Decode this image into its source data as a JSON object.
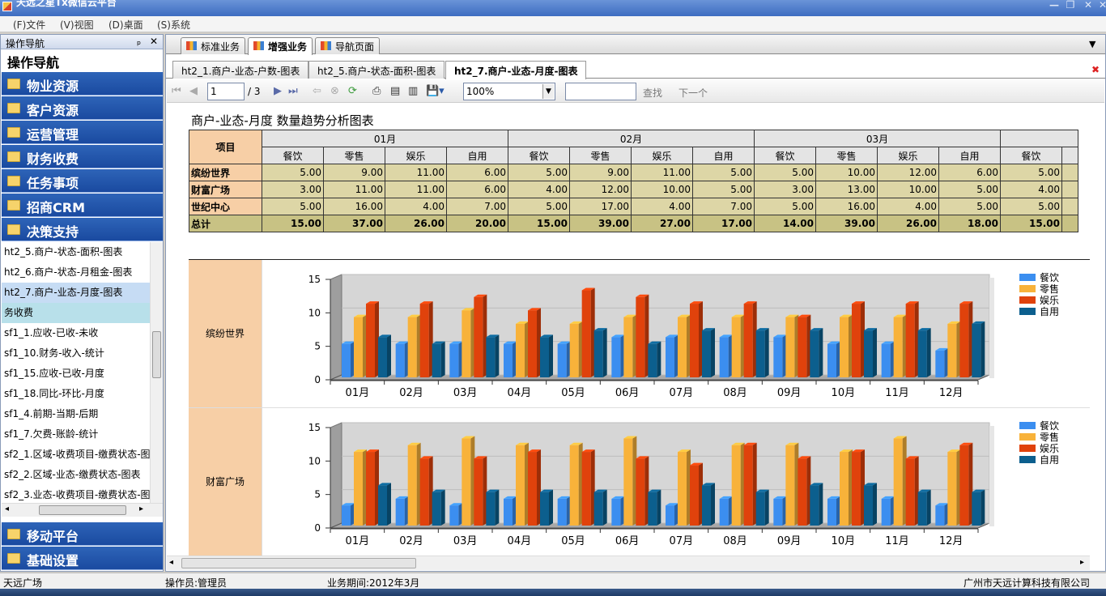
{
  "window": {
    "title": "天远之星Tx微信云平台"
  },
  "menu": [
    "(F)文件",
    "(V)视图",
    "(D)桌面",
    "(S)系统"
  ],
  "left_panel": {
    "header": "操作导航",
    "title": "操作导航",
    "nav_top": [
      "物业资源",
      "客户资源",
      "运营管理",
      "财务收费",
      "任务事项",
      "招商CRM",
      "决策支持"
    ],
    "sub_items": [
      "ht2_5.商户-状态-面积-图表",
      "ht2_6.商户-状态-月租金-图表",
      "ht2_7.商户-业态-月度-图表",
      "务收费",
      "sf1_1.应收-已收-未收",
      "sf1_10.财务-收入-统计",
      "sf1_15.应收-已收-月度",
      "sf1_18.同比-环比-月度",
      "sf1_4.前期-当期-后期",
      "sf1_7.欠费-账龄-统计",
      "sf2_1.区域-收费项目-缴费状态-图",
      "sf2_2.区域-业态-缴费状态-图表",
      "sf2_3.业态-收费项目-缴费状态-图"
    ],
    "nav_bottom": [
      "移动平台",
      "基础设置"
    ]
  },
  "top_tabs": [
    "标准业务",
    "增强业务",
    "导航页面"
  ],
  "sub_tabs": [
    "ht2_1.商户-业态-户数-图表",
    "ht2_5.商户-状态-面积-图表",
    "ht2_7.商户-业态-月度-图表"
  ],
  "toolbar": {
    "page": "1",
    "total": "/ 3",
    "zoom": "100%",
    "find": "查找",
    "next": "下一个"
  },
  "report": {
    "title": "商户-业态-月度 数量趋势分析图表",
    "corner": "项目",
    "months": [
      "01月",
      "02月",
      "03月"
    ],
    "types": [
      "餐饮",
      "零售",
      "娱乐",
      "自用"
    ],
    "extra_col": "餐饮",
    "rows": [
      {
        "name": "缤纷世界",
        "values": [
          "5.00",
          "9.00",
          "11.00",
          "6.00",
          "5.00",
          "9.00",
          "11.00",
          "5.00",
          "5.00",
          "10.00",
          "12.00",
          "6.00",
          "5.00"
        ]
      },
      {
        "name": "财富广场",
        "values": [
          "3.00",
          "11.00",
          "11.00",
          "6.00",
          "4.00",
          "12.00",
          "10.00",
          "5.00",
          "3.00",
          "13.00",
          "10.00",
          "5.00",
          "4.00"
        ]
      },
      {
        "name": "世纪中心",
        "values": [
          "5.00",
          "16.00",
          "4.00",
          "7.00",
          "5.00",
          "17.00",
          "4.00",
          "7.00",
          "5.00",
          "16.00",
          "4.00",
          "5.00",
          "5.00"
        ]
      },
      {
        "name": "总计",
        "values": [
          "15.00",
          "37.00",
          "26.00",
          "20.00",
          "15.00",
          "39.00",
          "27.00",
          "17.00",
          "14.00",
          "39.00",
          "26.00",
          "18.00",
          "15.00"
        ]
      }
    ]
  },
  "chart_data": [
    {
      "type": "bar",
      "title": "缤纷世界",
      "categories": [
        "01月",
        "02月",
        "03月",
        "04月",
        "05月",
        "06月",
        "07月",
        "08月",
        "09月",
        "10月",
        "11月",
        "12月"
      ],
      "ylim": [
        0,
        15
      ],
      "yticks": [
        "0",
        "5",
        "10",
        "15"
      ],
      "series": [
        {
          "name": "餐饮",
          "values": [
            5,
            5,
            5,
            5,
            5,
            6,
            6,
            6,
            6,
            5,
            5,
            4
          ]
        },
        {
          "name": "零售",
          "values": [
            9,
            9,
            10,
            8,
            8,
            9,
            9,
            9,
            9,
            9,
            9,
            8
          ]
        },
        {
          "name": "娱乐",
          "values": [
            11,
            11,
            12,
            10,
            13,
            12,
            11,
            11,
            9,
            11,
            11,
            11
          ]
        },
        {
          "name": "自用",
          "values": [
            6,
            5,
            6,
            6,
            7,
            5,
            7,
            7,
            7,
            7,
            7,
            8
          ]
        }
      ]
    },
    {
      "type": "bar",
      "title": "财富广场",
      "categories": [
        "01月",
        "02月",
        "03月",
        "04月",
        "05月",
        "06月",
        "07月",
        "08月",
        "09月",
        "10月",
        "11月",
        "12月"
      ],
      "ylim": [
        0,
        15
      ],
      "yticks": [
        "0",
        "5",
        "10",
        "15"
      ],
      "series": [
        {
          "name": "餐饮",
          "values": [
            3,
            4,
            3,
            4,
            4,
            4,
            3,
            4,
            4,
            4,
            4,
            3
          ]
        },
        {
          "name": "零售",
          "values": [
            11,
            12,
            13,
            12,
            12,
            13,
            11,
            12,
            12,
            11,
            13,
            11
          ]
        },
        {
          "name": "娱乐",
          "values": [
            11,
            10,
            10,
            11,
            11,
            10,
            9,
            12,
            10,
            11,
            10,
            12
          ]
        },
        {
          "name": "自用",
          "values": [
            6,
            5,
            5,
            5,
            5,
            5,
            6,
            5,
            6,
            6,
            5,
            5
          ]
        }
      ]
    }
  ],
  "colors": {
    "餐饮": "#3b8ef0",
    "零售": "#f8b23a",
    "娱乐": "#e0420c",
    "自用": "#0c5f8e"
  },
  "status": {
    "location": "天远广场",
    "operator": "操作员:管理员",
    "period": "业务期间:2012年3月",
    "company": "广州市天远计算科技有限公司"
  }
}
